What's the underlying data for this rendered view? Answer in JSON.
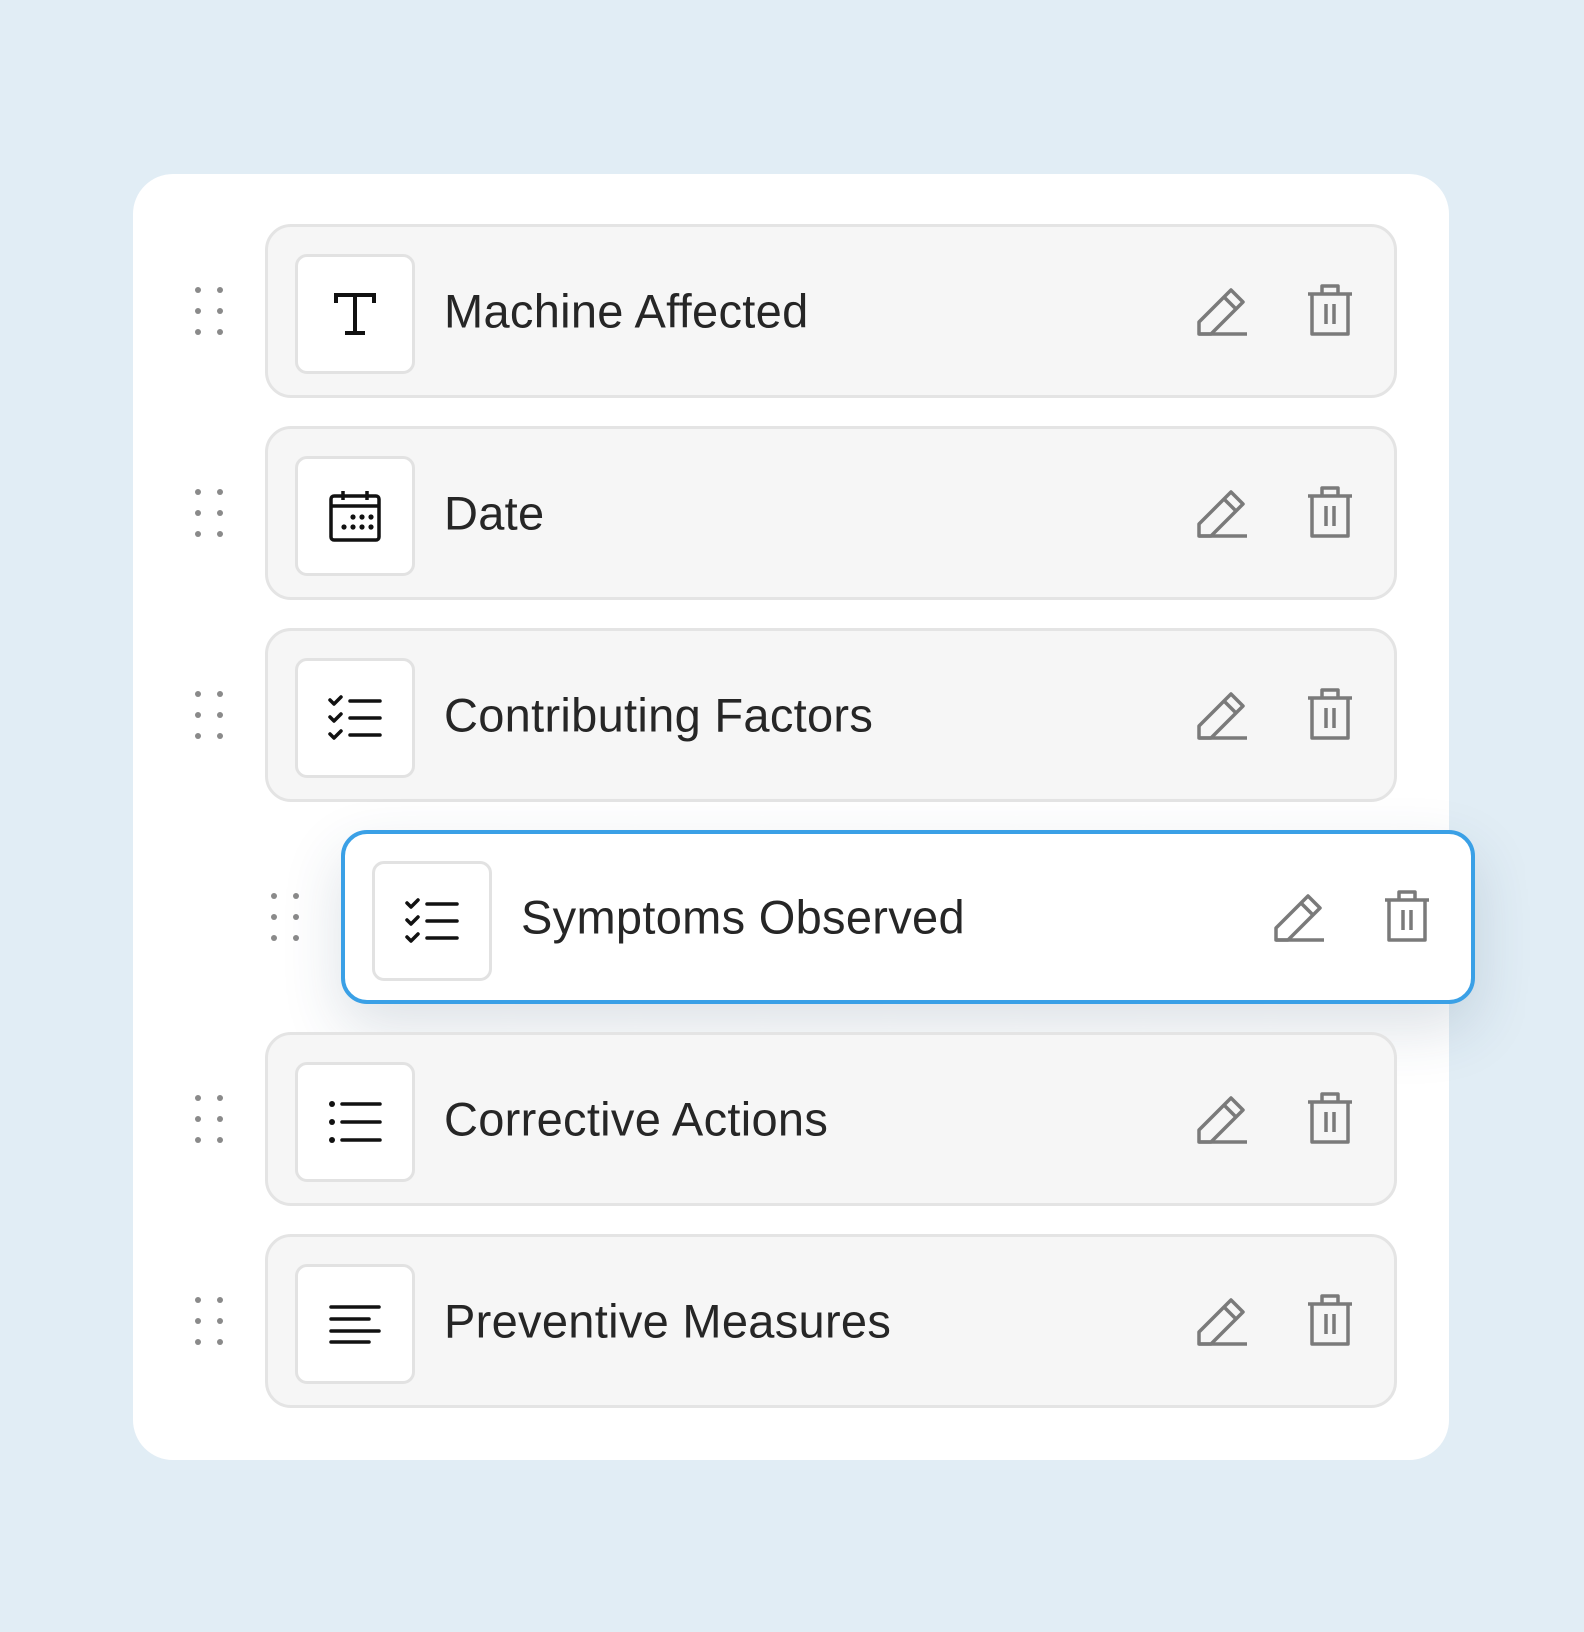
{
  "fields": [
    {
      "label": "Machine Affected",
      "type_icon": "text-type-icon"
    },
    {
      "label": "Date",
      "type_icon": "calendar-icon"
    },
    {
      "label": "Contributing Factors",
      "type_icon": "checklist-icon"
    },
    {
      "label": "Symptoms Observed",
      "type_icon": "checklist-icon",
      "state": "dragging"
    },
    {
      "label": "Corrective Actions",
      "type_icon": "bulleted-list-icon"
    },
    {
      "label": "Preventive Measures",
      "type_icon": "paragraph-icon"
    }
  ],
  "actions": {
    "edit_icon": "pencil-icon",
    "delete_icon": "trash-icon"
  },
  "colors": {
    "background": "#e1edf5",
    "card": "#ffffff",
    "row": "#f6f6f6",
    "drag_highlight": "#3aa0e6"
  }
}
